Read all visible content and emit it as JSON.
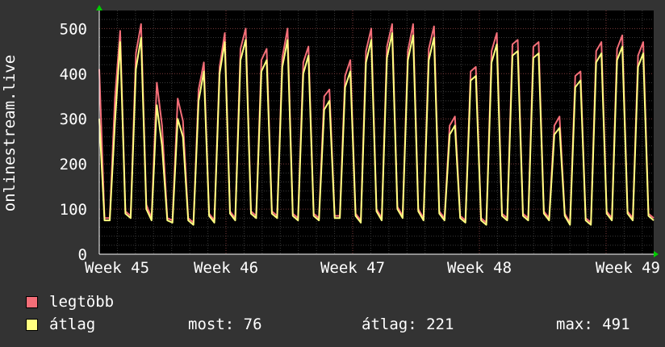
{
  "chart_data": {
    "type": "line",
    "ylabel": "onlinestream.live",
    "ylim": [
      0,
      540
    ],
    "yticks": [
      0,
      100,
      200,
      300,
      400,
      500
    ],
    "x_tick_labels": [
      "Week 45",
      "Week 46",
      "Week 47",
      "Week 48",
      "Week 49"
    ],
    "series": [
      {
        "name": "legtöbb",
        "color": "#f46e78",
        "values": [
          410,
          80,
          80,
          345,
          495,
          95,
          85,
          445,
          510,
          110,
          80,
          380,
          285,
          80,
          75,
          345,
          295,
          80,
          70,
          365,
          425,
          90,
          75,
          415,
          490,
          95,
          80,
          455,
          500,
          95,
          85,
          430,
          455,
          95,
          85,
          435,
          500,
          90,
          80,
          425,
          460,
          90,
          80,
          350,
          365,
          85,
          85,
          395,
          430,
          90,
          75,
          450,
          500,
          100,
          80,
          460,
          510,
          105,
          85,
          450,
          510,
          100,
          80,
          455,
          505,
          95,
          80,
          285,
          305,
          85,
          75,
          405,
          415,
          80,
          70,
          450,
          490,
          90,
          80,
          465,
          475,
          90,
          80,
          460,
          470,
          95,
          80,
          285,
          305,
          90,
          70,
          395,
          405,
          80,
          70,
          450,
          470,
          95,
          80,
          455,
          485,
          95,
          80,
          440,
          470,
          90,
          80
        ]
      },
      {
        "name": "átlag",
        "color": "#ffff80",
        "values": [
          300,
          75,
          75,
          290,
          470,
          90,
          80,
          410,
          480,
          100,
          75,
          330,
          240,
          75,
          70,
          300,
          260,
          75,
          65,
          340,
          405,
          85,
          70,
          400,
          470,
          90,
          75,
          430,
          475,
          90,
          80,
          405,
          430,
          90,
          80,
          415,
          475,
          85,
          75,
          400,
          440,
          85,
          75,
          320,
          340,
          80,
          80,
          370,
          405,
          85,
          70,
          425,
          475,
          95,
          75,
          435,
          490,
          100,
          80,
          430,
          485,
          95,
          75,
          430,
          480,
          90,
          75,
          265,
          285,
          80,
          70,
          385,
          395,
          75,
          65,
          425,
          465,
          85,
          75,
          440,
          450,
          85,
          75,
          435,
          445,
          90,
          75,
          265,
          280,
          85,
          65,
          370,
          385,
          75,
          65,
          425,
          445,
          90,
          75,
          430,
          460,
          90,
          75,
          415,
          445,
          85,
          75
        ]
      }
    ],
    "grid": true
  },
  "legend": {
    "max_label": "legtöbb",
    "avg_label": "átlag",
    "max_color": "#f46e78",
    "avg_color": "#ffff80"
  },
  "stats": {
    "now": "most: 76",
    "avg": "átlag: 221",
    "max": "max: 491"
  }
}
